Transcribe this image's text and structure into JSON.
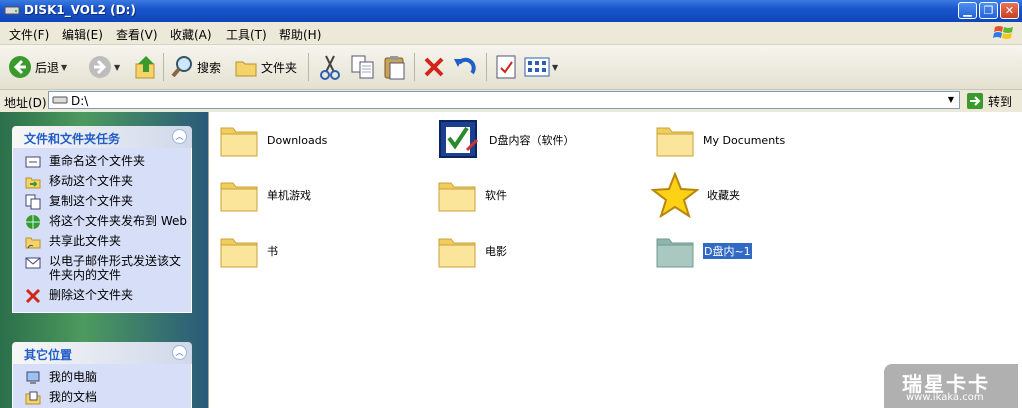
{
  "window": {
    "title": "DISK1_VOL2 (D:)",
    "min": "▁",
    "max": "❐",
    "close": "✕"
  },
  "menu": [
    "文件(F)",
    "编辑(E)",
    "查看(V)",
    "收藏(A)",
    "工具(T)",
    "帮助(H)"
  ],
  "toolbar": {
    "back": "后退",
    "search": "搜索",
    "folders": "文件夹"
  },
  "address": {
    "label": "地址(D)",
    "value": "D:\\",
    "go": "转到"
  },
  "tasks": {
    "header": "文件和文件夹任务",
    "items": [
      "重命名这个文件夹",
      "移动这个文件夹",
      "复制这个文件夹",
      "将这个文件夹发布到 Web",
      "共享此文件夹",
      "以电子邮件形式发送该文件夹内的文件",
      "删除这个文件夹"
    ]
  },
  "places": {
    "header": "其它位置",
    "items": [
      "我的电脑",
      "我的文档"
    ]
  },
  "files": [
    {
      "name": "Downloads",
      "icon": "folder-icon"
    },
    {
      "name": "D盘内容（软件）",
      "icon": "notepad-check-icon"
    },
    {
      "name": "My Documents",
      "icon": "folder-icon"
    },
    {
      "name": "单机游戏",
      "icon": "folder-icon"
    },
    {
      "name": "软件",
      "icon": "folder-icon"
    },
    {
      "name": "收藏夹",
      "icon": "star-icon"
    },
    {
      "name": "书",
      "icon": "folder-icon"
    },
    {
      "name": "电影",
      "icon": "folder-icon"
    },
    {
      "name": "D盘内~1",
      "icon": "hidden-folder-icon"
    }
  ],
  "watermark": {
    "main": "瑞星卡卡",
    "url": "www.ikaka.com"
  },
  "colors": {
    "title": "#0f46b8",
    "selection": "#316ac5",
    "task_text": "#215dc6"
  }
}
